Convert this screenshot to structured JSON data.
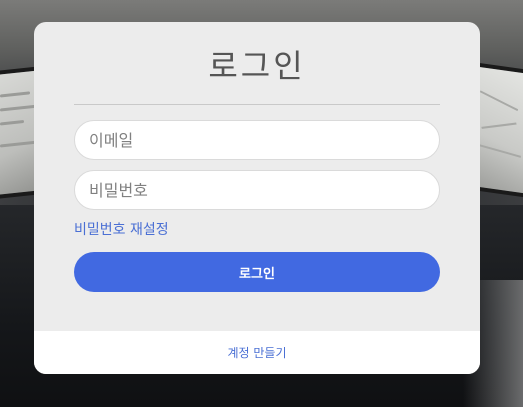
{
  "login": {
    "title": "로그인",
    "email_placeholder": "이메일",
    "password_placeholder": "비밀번호",
    "reset_password_label": "비밀번호 재설정",
    "login_button_label": "로그인",
    "create_account_label": "계정 만들기"
  },
  "colors": {
    "primary": "#4169e1",
    "link": "#4a6fd4",
    "card_background": "#ececec"
  }
}
